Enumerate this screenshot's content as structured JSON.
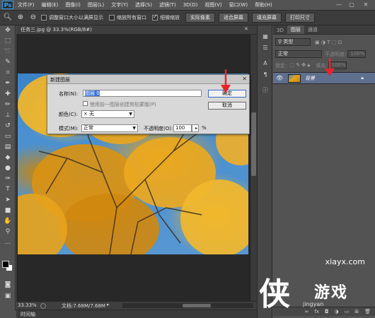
{
  "app": {
    "logo": "Ps"
  },
  "menu": [
    "文件(F)",
    "编辑(E)",
    "图像(I)",
    "图层(L)",
    "文字(Y)",
    "选择(S)",
    "滤镜(T)",
    "3D(D)",
    "视图(V)",
    "窗口(W)",
    "帮助(H)"
  ],
  "window_controls": {
    "minimize": "—",
    "restore": "▢",
    "close": "✕"
  },
  "options_bar": {
    "check_resize": "调整窗口大小以满屏显示",
    "check_zoom_all": "缩放所有窗口",
    "check_scrubby": "细微缩放",
    "btn_actual": "实际像素",
    "btn_fit": "适合屏幕",
    "btn_fill": "填充屏幕",
    "btn_print": "打印尺寸"
  },
  "document": {
    "tab_title": "任务三.jpg @ 33.3%(RGB/8#)",
    "tab_close": "✕",
    "zoom": "33.33%",
    "doc_info": "文档:7.68M/7.68M"
  },
  "timeline": {
    "label": "时间轴"
  },
  "dialog": {
    "title": "新建图层",
    "name_label": "名称(N):",
    "name_value": "图层 0",
    "clip_label": "使用前一图层创建剪贴蒙版(P)",
    "color_label": "颜色(C):",
    "color_value": "无",
    "color_prefix": "×",
    "mode_label": "模式(M):",
    "mode_value": "正常",
    "opacity_label": "不透明度(O):",
    "opacity_value": "100",
    "opacity_unit": "%",
    "ok": "确定",
    "cancel": "取消"
  },
  "layers_panel": {
    "tabs": [
      "3D",
      "图层",
      "通道"
    ],
    "kind_label": "类型",
    "blend_mode": "正常",
    "opacity_label": "不透明度:",
    "opacity_value": "100%",
    "lock_label": "锁定:",
    "fill_label": "填充:",
    "fill_value": "100%",
    "layer_name": "背景"
  },
  "watermark": {
    "url": "xiayx.com",
    "text": "游戏",
    "glyph": "侠",
    "bottom": "jingyan"
  },
  "colors": {
    "annotation_red": "#e3262b",
    "selection_blue": "#3875d7"
  }
}
